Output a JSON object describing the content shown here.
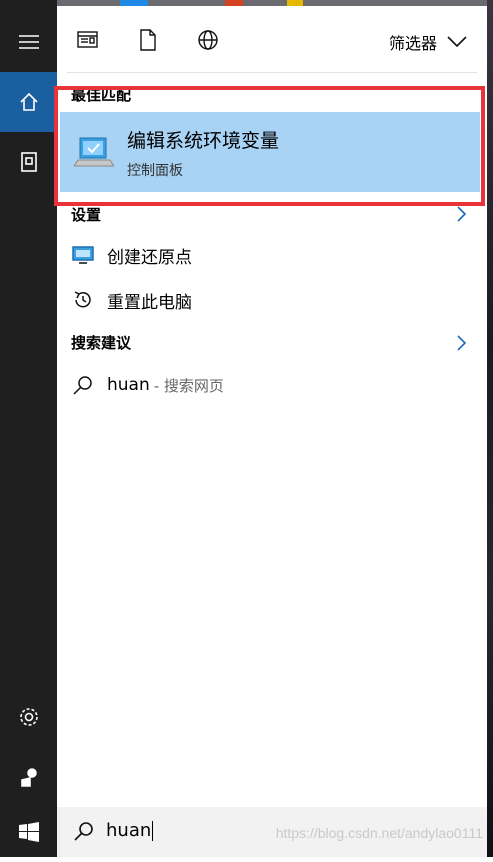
{
  "toolbar": {
    "icons": [
      "documents-app-icon",
      "document-icon",
      "web-globe-icon"
    ],
    "filter_label": "筛选器"
  },
  "sections": {
    "best_match_title": "最佳匹配",
    "settings_title": "设置",
    "suggestions_title": "搜索建议"
  },
  "best_match": {
    "title": "编辑系统环境变量",
    "subtitle": "控制面板"
  },
  "settings_items": [
    {
      "label": "创建还原点",
      "icon": "system-restore-icon"
    },
    {
      "label": "重置此电脑",
      "icon": "reset-pc-icon"
    }
  ],
  "suggestion": {
    "query": "huan",
    "suffix": "- 搜索网页"
  },
  "search": {
    "value": "huan"
  },
  "watermark": "https://blog.csdn.net/andylao0111",
  "colors": {
    "rail": "#1f1f1f",
    "rail_active": "#1a5fa0",
    "selection": "#a9d3f5",
    "highlight_border": "#e8333a",
    "chevron": "#1a6ac0"
  }
}
